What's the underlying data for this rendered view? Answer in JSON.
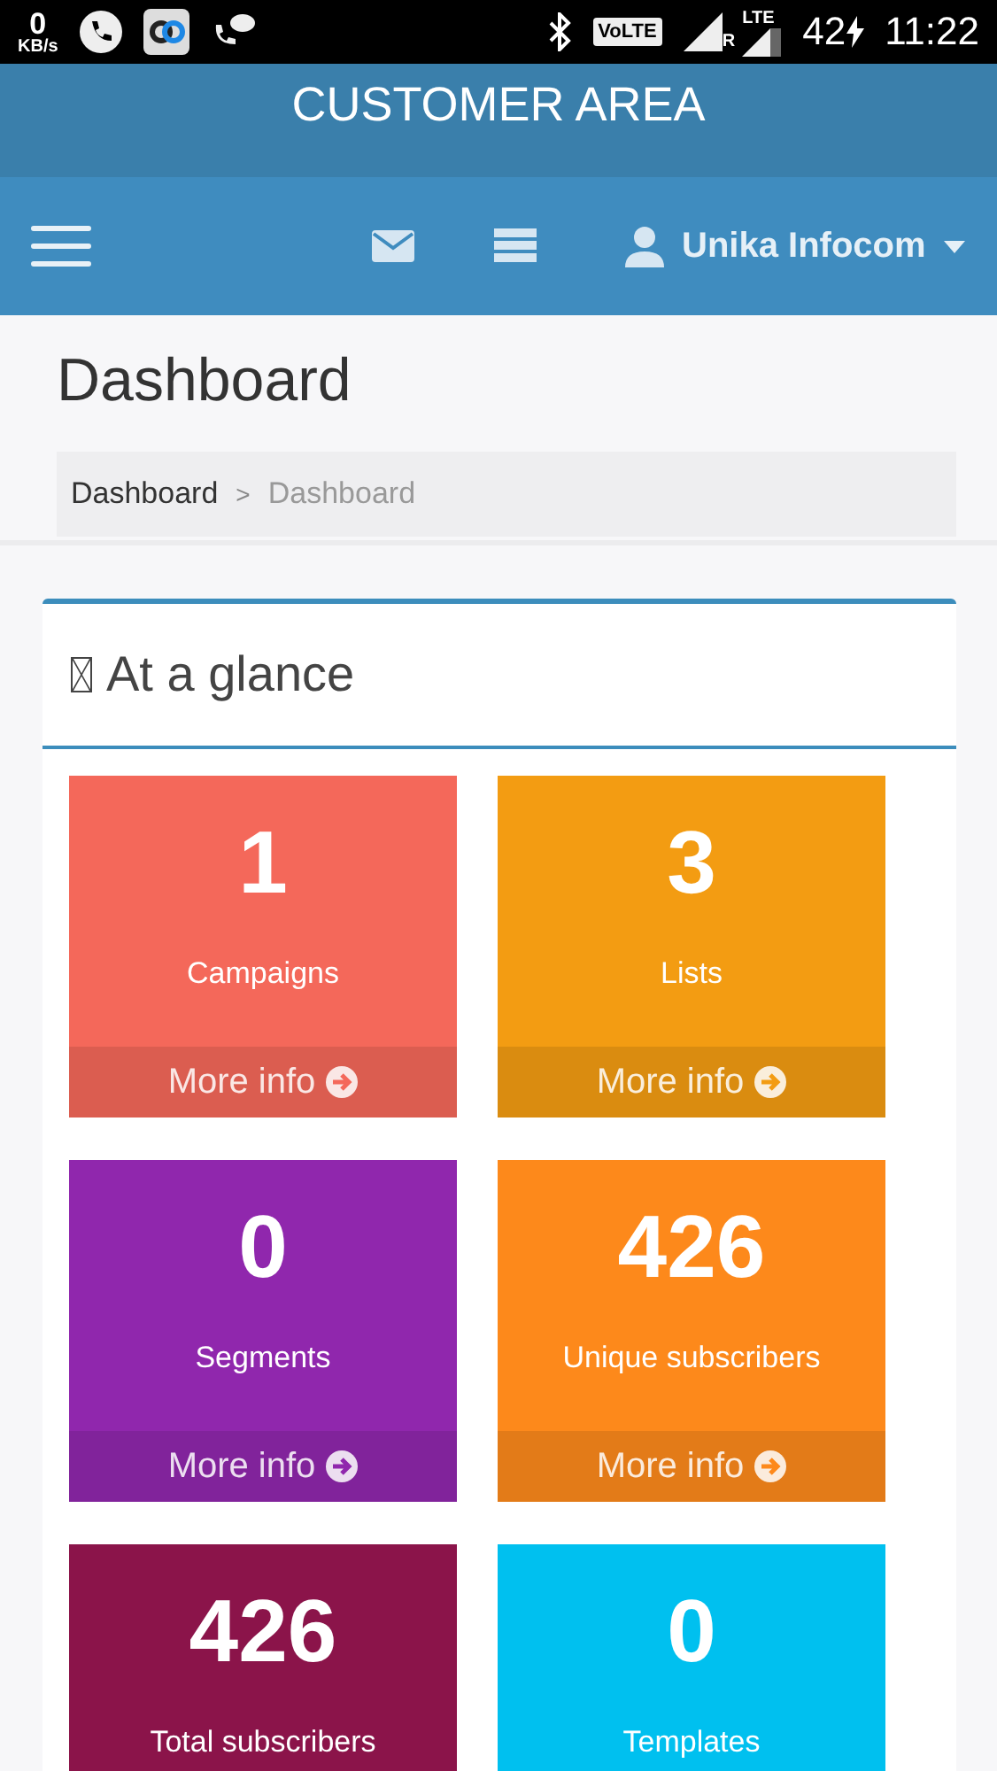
{
  "status_bar": {
    "speed_value": "0",
    "speed_unit": "KB/s",
    "volte": "VoLTE",
    "roaming": "R",
    "network": "LTE",
    "battery": "42",
    "time": "11:22"
  },
  "header": {
    "title": "CUSTOMER AREA"
  },
  "navbar": {
    "user": "Unika Infocom"
  },
  "page": {
    "title": "Dashboard",
    "breadcrumb": [
      {
        "label": "Dashboard",
        "selected": false
      },
      {
        "label": "Dashboard",
        "selected": true
      }
    ],
    "separator": ">"
  },
  "panel": {
    "title": "At a glance"
  },
  "tiles": [
    {
      "value": "1",
      "label": "Campaigns",
      "link": "More info",
      "color": "#f4685a"
    },
    {
      "value": "3",
      "label": "Lists",
      "link": "More info",
      "color": "#f39c12"
    },
    {
      "value": "0",
      "label": "Segments",
      "link": "More info",
      "color": "#9027ad"
    },
    {
      "value": "426",
      "label": "Unique subscribers",
      "link": "More info",
      "color": "#fd891b"
    },
    {
      "value": "426",
      "label": "Total subscribers",
      "color": "#8b144a"
    },
    {
      "value": "0",
      "label": "Templates",
      "color": "#00c0ef"
    }
  ]
}
